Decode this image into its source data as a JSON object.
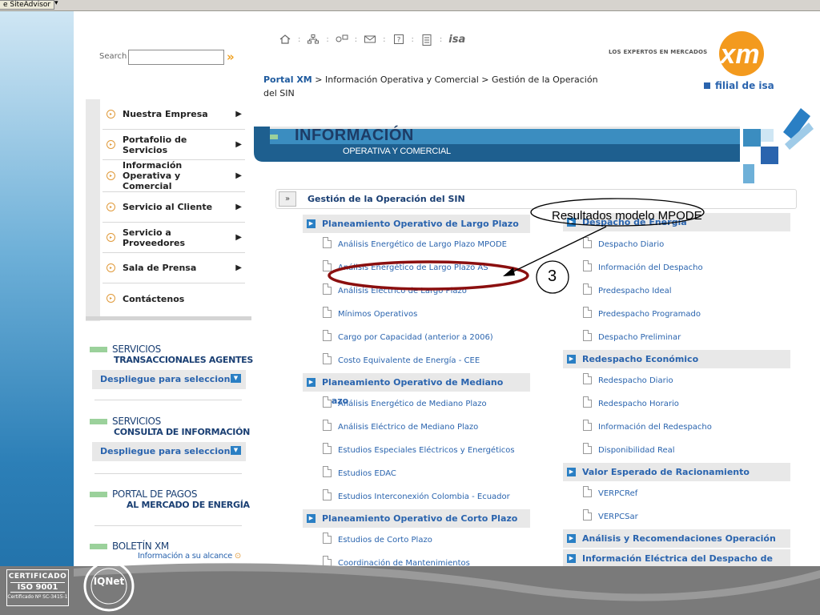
{
  "browser": {
    "addon_label": "e SiteAdvisor"
  },
  "search": {
    "label": "Search",
    "value": ""
  },
  "top_icons": [
    "home-icon",
    "sitemap-icon",
    "contact-icon",
    "mail-icon",
    "help-icon",
    "document-icon",
    "isa-logo"
  ],
  "isa_text": "isa",
  "breadcrumb": {
    "home": "Portal XM",
    "rest": " > Información Operativa y Comercial > Gestión de la Operación del SIN"
  },
  "logo": {
    "tagline": "LOS EXPERTOS EN MERCADOS",
    "filial": "filial de isa",
    "colors": {
      "orange": "#f39a1e",
      "blue": "#2a64ae"
    }
  },
  "menu": [
    {
      "label": "Nuestra Empresa",
      "arrow": true
    },
    {
      "label": "Portafolio de Servicios",
      "arrow": true
    },
    {
      "label": "Información Operativa y Comercial",
      "arrow": true
    },
    {
      "label": "Servicio al Cliente",
      "arrow": true
    },
    {
      "label": "Servicio a Proveedores",
      "arrow": true
    },
    {
      "label": "Sala de Prensa",
      "arrow": true
    },
    {
      "label": "Contáctenos",
      "arrow": false
    }
  ],
  "services": [
    {
      "t1": "SERVICIOS",
      "t2": "TRANSACCIONALES AGENTES",
      "dropdown": "Despliegue para seleccionar"
    },
    {
      "t1": "SERVICIOS",
      "t2": "CONSULTA DE INFORMACIÓN",
      "dropdown": "Despliegue para seleccionar"
    },
    {
      "t1": "PORTAL DE PAGOS",
      "t2": "AL MERCADO DE ENERGÍA"
    },
    {
      "t1": "BOLETÍN XM",
      "t2": "Información a su alcance"
    }
  ],
  "banner": {
    "title": "INFORMACIÓN",
    "subtitle": "OPERATIVA Y COMERCIAL"
  },
  "section_title": "Gestión de la Operación del SIN",
  "left_col": {
    "groups": [
      {
        "title": "Planeamiento Operativo de Largo Plazo",
        "items": [
          "Análisis Energético de Largo Plazo MPODE",
          "Análisis Energético de Largo Plazo AS",
          "Análisis Eléctrico de Largo Plazo",
          "Mínimos Operativos",
          "Cargo por Capacidad (anterior a 2006)",
          "Costo Equivalente de Energía - CEE"
        ]
      },
      {
        "title": "Planeamiento Operativo de Mediano Plazo",
        "items": [
          "Análisis Energético de Mediano Plazo",
          "Análisis Eléctrico de Mediano Plazo",
          "Estudios Especiales Eléctricos y Energéticos",
          "Estudios EDAC",
          "Estudios Interconexión Colombia - Ecuador"
        ]
      },
      {
        "title": "Planeamiento Operativo de Corto Plazo",
        "items": [
          "Estudios de Corto Plazo",
          "Coordinación de Mantenimientos"
        ]
      }
    ]
  },
  "right_col": {
    "groups": [
      {
        "title": "Despacho de Energía",
        "items": [
          "Despacho Diario",
          "Información del Despacho",
          "Predespacho Ideal",
          "Predespacho Programado",
          "Despacho Preliminar"
        ]
      },
      {
        "title": "Redespacho Económico",
        "items": [
          "Redespacho Diario",
          "Redespacho Horario",
          "Información del Redespacho",
          "Disponibilidad Real"
        ]
      },
      {
        "title": "Valor Esperado de Racionamiento",
        "items": [
          "VERPCRef",
          "VERPCSar"
        ]
      },
      {
        "title": "Análisis y Recomendaciones Operación del SIN",
        "items": []
      },
      {
        "title": "Información Eléctrica del Despacho de",
        "items": []
      }
    ]
  },
  "annotation": {
    "label": "Resultados modelo MPODE",
    "number": "3",
    "color": "#8b0f0f"
  },
  "footer": {
    "cert_line1": "CERTIFICADO",
    "cert_line2": "ISO 9001",
    "cert_line3": "Certificado Nº SC-3415-1",
    "iqnet": "IQNet"
  }
}
